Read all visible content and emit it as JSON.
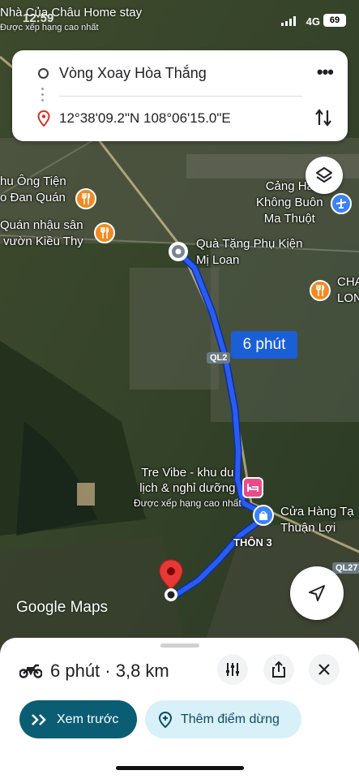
{
  "status_bar": {
    "time": "12:59",
    "network": "4G",
    "battery": "69"
  },
  "map_top": {
    "place": "Nhà Của Châu Home stay",
    "subtitle": "Được xếp hạng cao nhất"
  },
  "directions": {
    "origin": "Vòng Xoay Hòa Thắng",
    "destination": "12°38'09.2\"N 108°06'15.0\"E",
    "more_icon": "more-dots-icon",
    "swap_icon": "swap-vertical-icon"
  },
  "map_labels": {
    "place1_line1": "hu Ông Tiện",
    "place1_line2": "o Đan Quán",
    "place2_line1": "Quán nhậu sân",
    "place2_line2": "vườn Kiều Thy",
    "airport_line1": "Cảng Hà",
    "airport_line2": "Không Buôn",
    "airport_line3": "Ma Thuột",
    "gift_line1": "Quà Tặng Phụ Kiện",
    "gift_line2": "Mị Loan",
    "cha_line1": "CHA",
    "cha_line2": "LON",
    "road_ql": "QL2",
    "road_ql27": "QL27",
    "tre_line1": "Tre Vibe - khu du",
    "tre_line2": "lịch & nghỉ dưỡng",
    "tre_line3": "Được xếp hạng cao nhất",
    "shop_line1": "Cửa Hàng Tạ",
    "shop_line2": "Thuận Lợi",
    "village": "THÔN 3"
  },
  "route": {
    "duration_badge": "6 phút",
    "color": "#1a5fd6"
  },
  "brand": {
    "google": "Google",
    "maps": "Maps"
  },
  "sheet": {
    "trip_summary": "6 phút · 3,8 km",
    "mode_icon": "motorbike-icon",
    "preview_label": "Xem trước",
    "add_stop_label": "Thêm điểm dừng"
  }
}
